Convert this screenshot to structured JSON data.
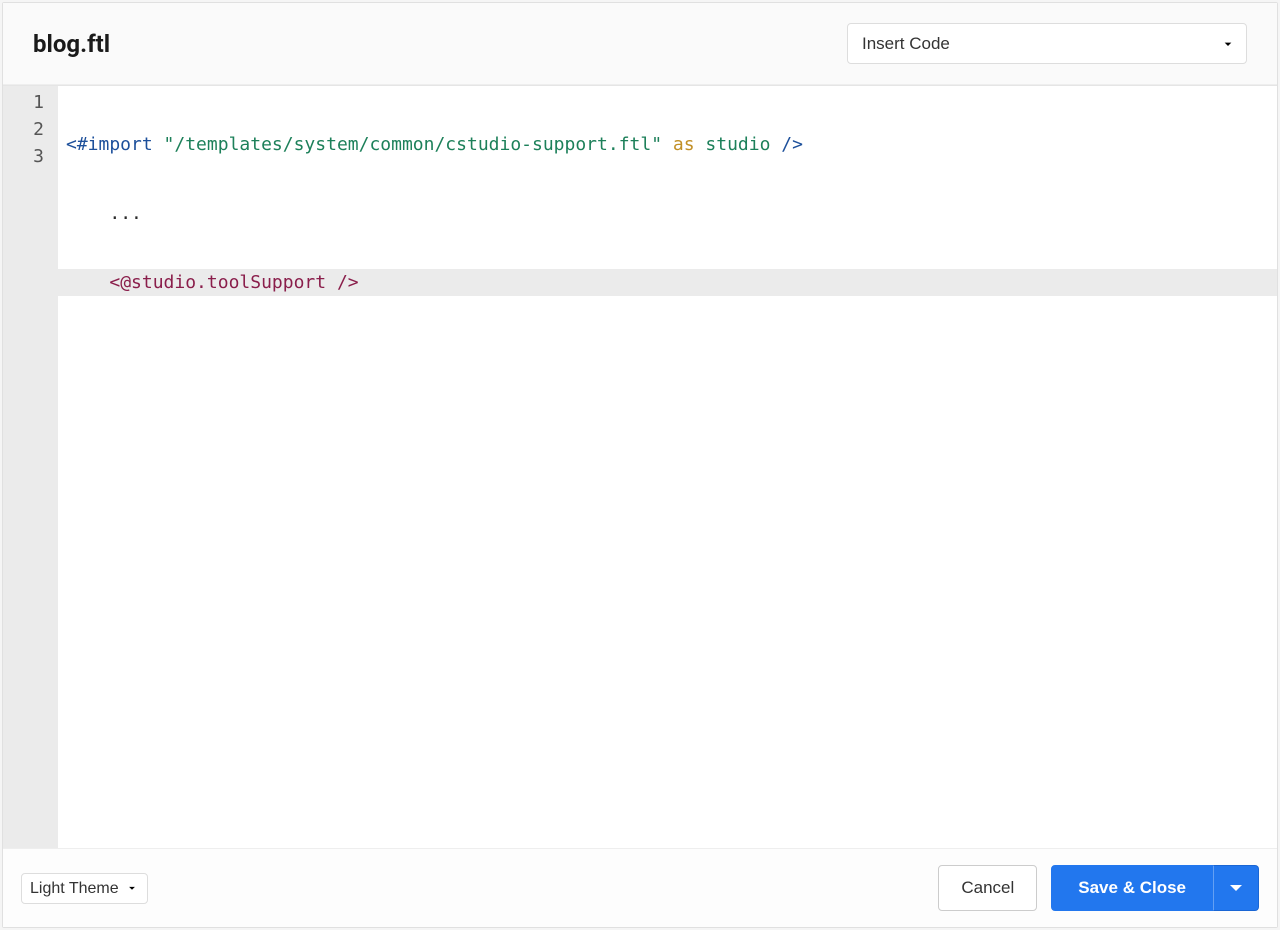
{
  "header": {
    "title": "blog.ftl",
    "insert_code_label": "Insert Code"
  },
  "editor": {
    "lines": [
      {
        "num": "1",
        "active": false
      },
      {
        "num": "2",
        "active": false
      },
      {
        "num": "3",
        "active": true
      }
    ],
    "code": {
      "line1": {
        "t1": "<#import",
        "t2": " ",
        "t3": "\"/templates/system/common/cstudio-support.ftl\"",
        "t4": " ",
        "t5": "as",
        "t6": " ",
        "t7": "studio",
        "t8": " ",
        "t9": "/>"
      },
      "line2": {
        "indent": "    ",
        "t1": "..."
      },
      "line3": {
        "indent": "    ",
        "t1": "<@studio.toolSupport",
        "t2": " ",
        "t3": "/>"
      }
    }
  },
  "footer": {
    "theme_label": "Light Theme",
    "cancel_label": "Cancel",
    "save_close_label": "Save & Close"
  }
}
